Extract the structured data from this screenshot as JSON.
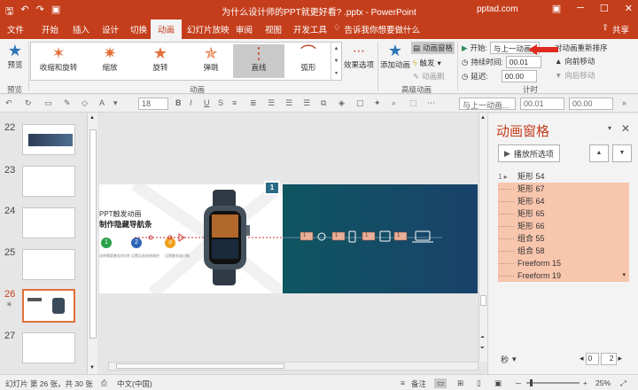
{
  "titlebar": {
    "title": "为什么设计师的PPT就更好看? .pptx - PowerPoint",
    "brand": "pptad.com",
    "qat_icons": [
      "save-icon",
      "undo-icon",
      "redo-icon",
      "present-icon"
    ],
    "qat_glyphs": [
      "🖫",
      "↶",
      "↷",
      "▣"
    ]
  },
  "tabs": {
    "items": [
      "文件",
      "开始",
      "插入",
      "设计",
      "切换",
      "动画",
      "幻灯片放映",
      "审阅",
      "视图",
      "开发工具"
    ],
    "active": "动画",
    "tell_me": "告诉我你想要做什么",
    "share": "共享"
  },
  "ribbon": {
    "preview": {
      "label": "预览",
      "group": "预览"
    },
    "gallery": [
      {
        "label": "收缩和旋转",
        "selected": false
      },
      {
        "label": "缩放",
        "selected": false
      },
      {
        "label": "旋转",
        "selected": false
      },
      {
        "label": "弹跳",
        "selected": false
      },
      {
        "label": "直线",
        "selected": true
      },
      {
        "label": "弧形",
        "selected": false
      }
    ],
    "effect_options": "效果选项",
    "animation_group": "动画",
    "add_animation": "添加动画",
    "animation_pane": "动画窗格",
    "trigger": "触发",
    "painter": "动画刷",
    "advanced_group": "高级动画",
    "start_label": "开始:",
    "start_value": "与上一动画...",
    "duration_label": "持续时间:",
    "duration_value": "00.01",
    "delay_label": "延迟:",
    "delay_value": "00.00",
    "reorder_title": "对动画重新排序",
    "move_earlier": "向前移动",
    "move_later": "向后移动",
    "timing_group": "计时"
  },
  "format_bar": {
    "font_size": "18",
    "start_value": "与上一动画...",
    "duration_value": "00.01",
    "delay_value": "00.00"
  },
  "thumbnails": {
    "items": [
      {
        "num": "22",
        "current": false
      },
      {
        "num": "23",
        "current": false
      },
      {
        "num": "24",
        "current": false
      },
      {
        "num": "25",
        "current": false
      },
      {
        "num": "26",
        "current": true
      },
      {
        "num": "27",
        "current": false
      }
    ]
  },
  "slide": {
    "title_line1": "PPT触发动画",
    "title_line2": "制作隐藏导航条",
    "step_numbers": [
      "1",
      "2",
      "3"
    ],
    "step_captions": [
      "选择需要触发的对象",
      "设置动画效果路径",
      "设置触发器对象"
    ],
    "badge": "1",
    "path_markers": [
      "1",
      "1",
      "1",
      "1"
    ]
  },
  "anim_pane": {
    "title": "动画窗格",
    "play_label": "播放所选项",
    "items": [
      {
        "lead": "1 ▸",
        "name": "矩形 54"
      },
      {
        "lead": "·······",
        "name": "矩形 67"
      },
      {
        "lead": "·······",
        "name": "矩形 64"
      },
      {
        "lead": "·······",
        "name": "矩形 65"
      },
      {
        "lead": "·······",
        "name": "矩形 66"
      },
      {
        "lead": "·······",
        "name": "组合 55"
      },
      {
        "lead": "·······",
        "name": "组合 58"
      },
      {
        "lead": "·······",
        "name": "Freeform 15"
      },
      {
        "lead": "·······",
        "name": "Freeform 19"
      }
    ],
    "seconds_label": "秒",
    "scale_start": "0",
    "scale_end": "2"
  },
  "status": {
    "slide_info": "幻灯片 第 26 张，共 30 张",
    "language": "中文(中国)",
    "notes": "备注",
    "zoom": "25%"
  },
  "colors": {
    "accent": "#c43e1c",
    "selection": "#f8c5ad",
    "star": "#e2703a"
  }
}
